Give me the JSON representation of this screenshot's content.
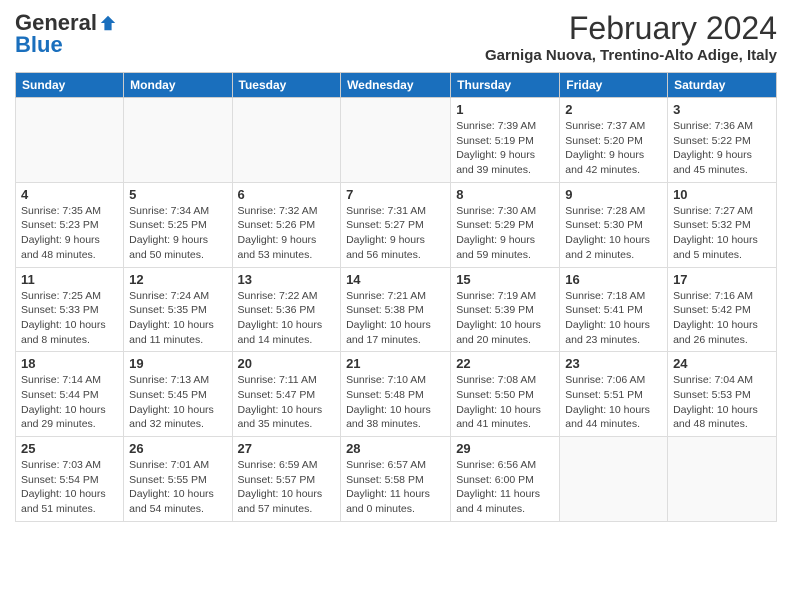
{
  "logo": {
    "general": "General",
    "blue": "Blue"
  },
  "title": "February 2024",
  "subtitle": "Garniga Nuova, Trentino-Alto Adige, Italy",
  "days_of_week": [
    "Sunday",
    "Monday",
    "Tuesday",
    "Wednesday",
    "Thursday",
    "Friday",
    "Saturday"
  ],
  "weeks": [
    [
      {
        "day": "",
        "info": ""
      },
      {
        "day": "",
        "info": ""
      },
      {
        "day": "",
        "info": ""
      },
      {
        "day": "",
        "info": ""
      },
      {
        "day": "1",
        "info": "Sunrise: 7:39 AM\nSunset: 5:19 PM\nDaylight: 9 hours\nand 39 minutes."
      },
      {
        "day": "2",
        "info": "Sunrise: 7:37 AM\nSunset: 5:20 PM\nDaylight: 9 hours\nand 42 minutes."
      },
      {
        "day": "3",
        "info": "Sunrise: 7:36 AM\nSunset: 5:22 PM\nDaylight: 9 hours\nand 45 minutes."
      }
    ],
    [
      {
        "day": "4",
        "info": "Sunrise: 7:35 AM\nSunset: 5:23 PM\nDaylight: 9 hours\nand 48 minutes."
      },
      {
        "day": "5",
        "info": "Sunrise: 7:34 AM\nSunset: 5:25 PM\nDaylight: 9 hours\nand 50 minutes."
      },
      {
        "day": "6",
        "info": "Sunrise: 7:32 AM\nSunset: 5:26 PM\nDaylight: 9 hours\nand 53 minutes."
      },
      {
        "day": "7",
        "info": "Sunrise: 7:31 AM\nSunset: 5:27 PM\nDaylight: 9 hours\nand 56 minutes."
      },
      {
        "day": "8",
        "info": "Sunrise: 7:30 AM\nSunset: 5:29 PM\nDaylight: 9 hours\nand 59 minutes."
      },
      {
        "day": "9",
        "info": "Sunrise: 7:28 AM\nSunset: 5:30 PM\nDaylight: 10 hours\nand 2 minutes."
      },
      {
        "day": "10",
        "info": "Sunrise: 7:27 AM\nSunset: 5:32 PM\nDaylight: 10 hours\nand 5 minutes."
      }
    ],
    [
      {
        "day": "11",
        "info": "Sunrise: 7:25 AM\nSunset: 5:33 PM\nDaylight: 10 hours\nand 8 minutes."
      },
      {
        "day": "12",
        "info": "Sunrise: 7:24 AM\nSunset: 5:35 PM\nDaylight: 10 hours\nand 11 minutes."
      },
      {
        "day": "13",
        "info": "Sunrise: 7:22 AM\nSunset: 5:36 PM\nDaylight: 10 hours\nand 14 minutes."
      },
      {
        "day": "14",
        "info": "Sunrise: 7:21 AM\nSunset: 5:38 PM\nDaylight: 10 hours\nand 17 minutes."
      },
      {
        "day": "15",
        "info": "Sunrise: 7:19 AM\nSunset: 5:39 PM\nDaylight: 10 hours\nand 20 minutes."
      },
      {
        "day": "16",
        "info": "Sunrise: 7:18 AM\nSunset: 5:41 PM\nDaylight: 10 hours\nand 23 minutes."
      },
      {
        "day": "17",
        "info": "Sunrise: 7:16 AM\nSunset: 5:42 PM\nDaylight: 10 hours\nand 26 minutes."
      }
    ],
    [
      {
        "day": "18",
        "info": "Sunrise: 7:14 AM\nSunset: 5:44 PM\nDaylight: 10 hours\nand 29 minutes."
      },
      {
        "day": "19",
        "info": "Sunrise: 7:13 AM\nSunset: 5:45 PM\nDaylight: 10 hours\nand 32 minutes."
      },
      {
        "day": "20",
        "info": "Sunrise: 7:11 AM\nSunset: 5:47 PM\nDaylight: 10 hours\nand 35 minutes."
      },
      {
        "day": "21",
        "info": "Sunrise: 7:10 AM\nSunset: 5:48 PM\nDaylight: 10 hours\nand 38 minutes."
      },
      {
        "day": "22",
        "info": "Sunrise: 7:08 AM\nSunset: 5:50 PM\nDaylight: 10 hours\nand 41 minutes."
      },
      {
        "day": "23",
        "info": "Sunrise: 7:06 AM\nSunset: 5:51 PM\nDaylight: 10 hours\nand 44 minutes."
      },
      {
        "day": "24",
        "info": "Sunrise: 7:04 AM\nSunset: 5:53 PM\nDaylight: 10 hours\nand 48 minutes."
      }
    ],
    [
      {
        "day": "25",
        "info": "Sunrise: 7:03 AM\nSunset: 5:54 PM\nDaylight: 10 hours\nand 51 minutes."
      },
      {
        "day": "26",
        "info": "Sunrise: 7:01 AM\nSunset: 5:55 PM\nDaylight: 10 hours\nand 54 minutes."
      },
      {
        "day": "27",
        "info": "Sunrise: 6:59 AM\nSunset: 5:57 PM\nDaylight: 10 hours\nand 57 minutes."
      },
      {
        "day": "28",
        "info": "Sunrise: 6:57 AM\nSunset: 5:58 PM\nDaylight: 11 hours\nand 0 minutes."
      },
      {
        "day": "29",
        "info": "Sunrise: 6:56 AM\nSunset: 6:00 PM\nDaylight: 11 hours\nand 4 minutes."
      },
      {
        "day": "",
        "info": ""
      },
      {
        "day": "",
        "info": ""
      }
    ]
  ]
}
